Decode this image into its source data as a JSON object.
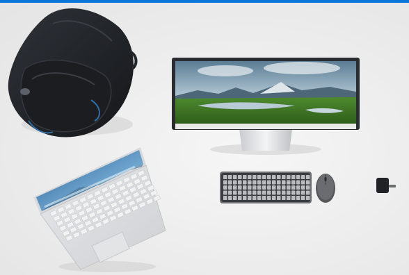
{
  "scene": {
    "kind": "product-photo",
    "accent_color": "#0a76d8",
    "background_color": "#ececec",
    "objects": [
      {
        "name": "backpack",
        "color": "#1e2126"
      },
      {
        "name": "laptop",
        "color": "#d9dadc"
      },
      {
        "name": "monitor",
        "color": "#2a2c30",
        "screen": "landscape-lake-mountains"
      },
      {
        "name": "keyboard",
        "color": "#3a3c40"
      },
      {
        "name": "mouse",
        "color": "#4a4c50"
      },
      {
        "name": "usb-adapter",
        "color": "#202226"
      }
    ]
  }
}
